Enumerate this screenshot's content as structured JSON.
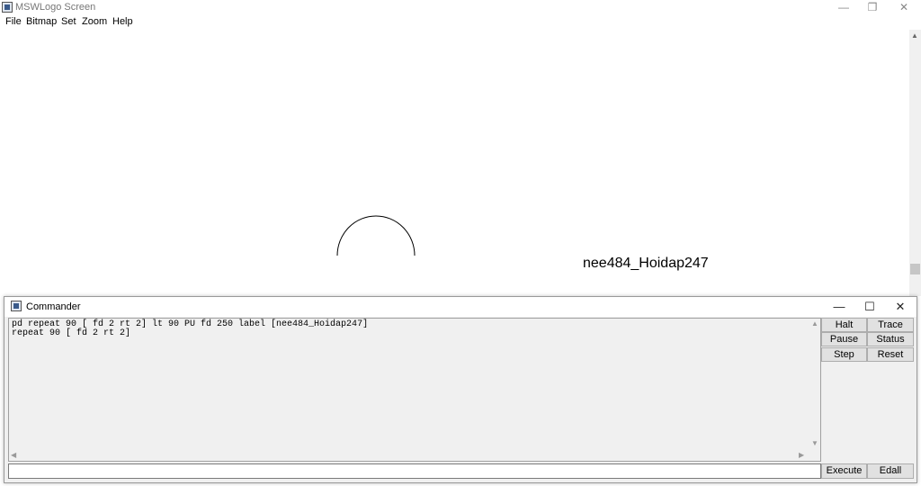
{
  "window": {
    "title": "MSWLogo Screen",
    "controls": {
      "minimize": "—",
      "restore": "❐",
      "close": "✕"
    }
  },
  "menu": [
    "File",
    "Bitmap",
    "Set",
    "Zoom",
    "Help"
  ],
  "canvas": {
    "label": "nee484_Hoidap247"
  },
  "commander": {
    "title": "Commander",
    "controls": {
      "minimize": "—",
      "maximize": "☐",
      "close": "✕"
    },
    "history": [
      "pd repeat 90 [ fd 2 rt 2] lt 90 PU fd 250 label [nee484_Hoidap247]",
      "repeat 90 [ fd 2 rt 2]"
    ],
    "input_value": "",
    "buttons": {
      "halt": "Halt",
      "trace": "Trace",
      "pause": "Pause",
      "status": "Status",
      "step": "Step",
      "reset": "Reset",
      "execute": "Execute",
      "edall": "Edall"
    }
  },
  "icons": {
    "app": "mswlogo-icon",
    "scroll_up": "▲",
    "scroll_down": "▼",
    "scroll_left": "◀",
    "scroll_right": "▶"
  }
}
